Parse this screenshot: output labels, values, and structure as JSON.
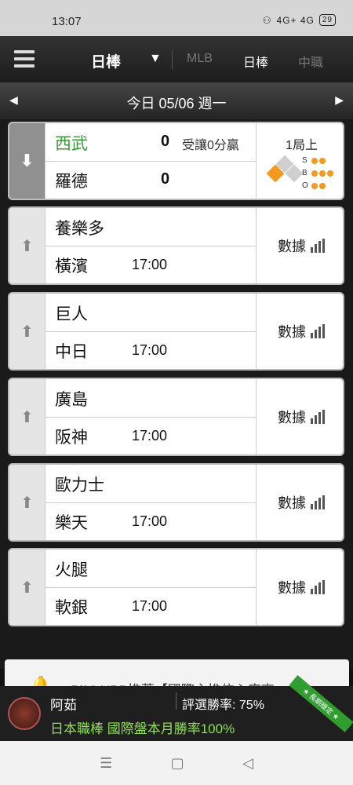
{
  "status": {
    "time": "13:07",
    "battery": "29",
    "signal_text": "4G+ 4G"
  },
  "nav": {
    "current": "日棒",
    "tabs": [
      {
        "label": "MLB",
        "active": false
      },
      {
        "label": "日棒",
        "active": true
      },
      {
        "label": "中職",
        "active": false
      }
    ]
  },
  "date_bar": {
    "text": "今日 05/06 週一"
  },
  "games": [
    {
      "status": "live",
      "home": "西武",
      "away": "羅德",
      "home_score": "0",
      "away_score": "0",
      "handicap": "受讓0分贏",
      "inning": "1局上",
      "sbo": {
        "S": "S",
        "B": "B",
        "O": "O"
      }
    },
    {
      "status": "scheduled",
      "home": "養樂多",
      "away": "橫濱",
      "time": "17:00",
      "data_label": "數據"
    },
    {
      "status": "scheduled",
      "home": "巨人",
      "away": "中日",
      "time": "17:00",
      "data_label": "數據"
    },
    {
      "status": "scheduled",
      "home": "廣島",
      "away": "阪神",
      "time": "17:00",
      "data_label": "數據"
    },
    {
      "status": "scheduled",
      "home": "歐力士",
      "away": "樂天",
      "time": "17:00",
      "data_label": "數據"
    },
    {
      "status": "scheduled",
      "home": "火腿",
      "away": "軟銀",
      "time": "17:00",
      "data_label": "數據"
    }
  ],
  "promo": {
    "text": "5/06 NPB推薦【國際主推信心度高"
  },
  "ad": {
    "name": "阿茹",
    "rate": "評選勝率: 75%",
    "desc": "日本職棒 國際盤本月勝率100%",
    "badge": "★ 長期穩定 ★"
  },
  "colors": {
    "live_team": "#3a9a3a",
    "accent": "#f39a1e",
    "ad_text": "#8ee24a"
  }
}
